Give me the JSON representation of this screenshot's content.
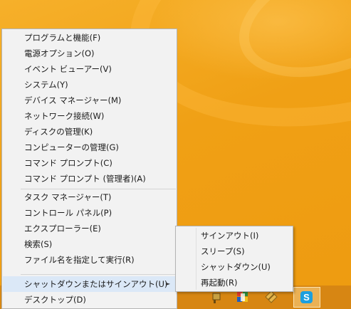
{
  "desktop": {
    "accent_color": "#f0a313"
  },
  "menu": {
    "groups": [
      [
        "プログラムと機能(F)",
        "電源オプション(O)",
        "イベント ビューアー(V)",
        "システム(Y)",
        "デバイス マネージャー(M)",
        "ネットワーク接続(W)",
        "ディスクの管理(K)",
        "コンピューターの管理(G)",
        "コマンド プロンプト(C)",
        "コマンド プロンプト (管理者)(A)"
      ],
      [
        "タスク マネージャー(T)",
        "コントロール パネル(P)",
        "エクスプローラー(E)",
        "検索(S)",
        "ファイル名を指定して実行(R)"
      ],
      [
        "シャットダウンまたはサインアウト(U)",
        "デスクトップ(D)"
      ]
    ],
    "submenu_arrow": "►"
  },
  "submenu": {
    "items": [
      "サインアウト(I)",
      "スリープ(S)",
      "シャットダウン(U)",
      "再起動(R)"
    ]
  },
  "taskbar": {
    "skype_label": "S",
    "icons": [
      "flag-icon",
      "paint-icon",
      "pin-icon",
      "skype-icon"
    ]
  }
}
